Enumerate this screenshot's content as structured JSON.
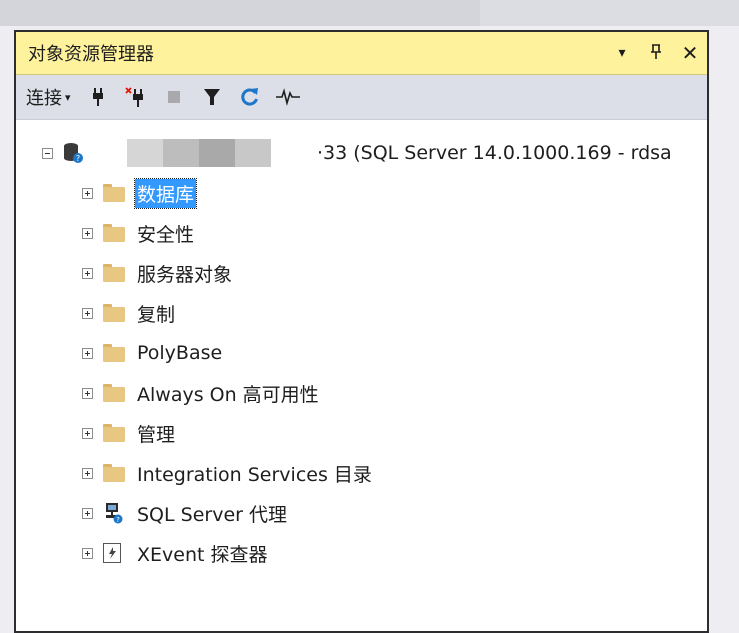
{
  "panel": {
    "title": "对象资源管理器",
    "controls": {
      "dropdown": "▾",
      "pin": "ᛘ",
      "close": "✕"
    }
  },
  "toolbar": {
    "connect_label": "连接",
    "connect_caret": "▾"
  },
  "tree": {
    "server": {
      "label": "·33 (SQL Server 14.0.1000.169 - rdsa"
    },
    "items": [
      {
        "label": "数据库",
        "icon": "folder-icon",
        "selected": true
      },
      {
        "label": "安全性",
        "icon": "folder-icon"
      },
      {
        "label": "服务器对象",
        "icon": "folder-icon"
      },
      {
        "label": "复制",
        "icon": "folder-icon"
      },
      {
        "label": "PolyBase",
        "icon": "folder-icon"
      },
      {
        "label": "Always On 高可用性",
        "icon": "folder-icon"
      },
      {
        "label": "管理",
        "icon": "folder-icon"
      },
      {
        "label": "Integration Services 目录",
        "icon": "folder-icon"
      },
      {
        "label": "SQL Server 代理",
        "icon": "sql-agent-icon"
      },
      {
        "label": "XEvent 探查器",
        "icon": "xevent-icon"
      }
    ]
  },
  "colors": {
    "title_bar": "#fff29d",
    "toolbar": "#dcdfe7",
    "selection": "#3399ff",
    "folder": "#e8c782"
  }
}
